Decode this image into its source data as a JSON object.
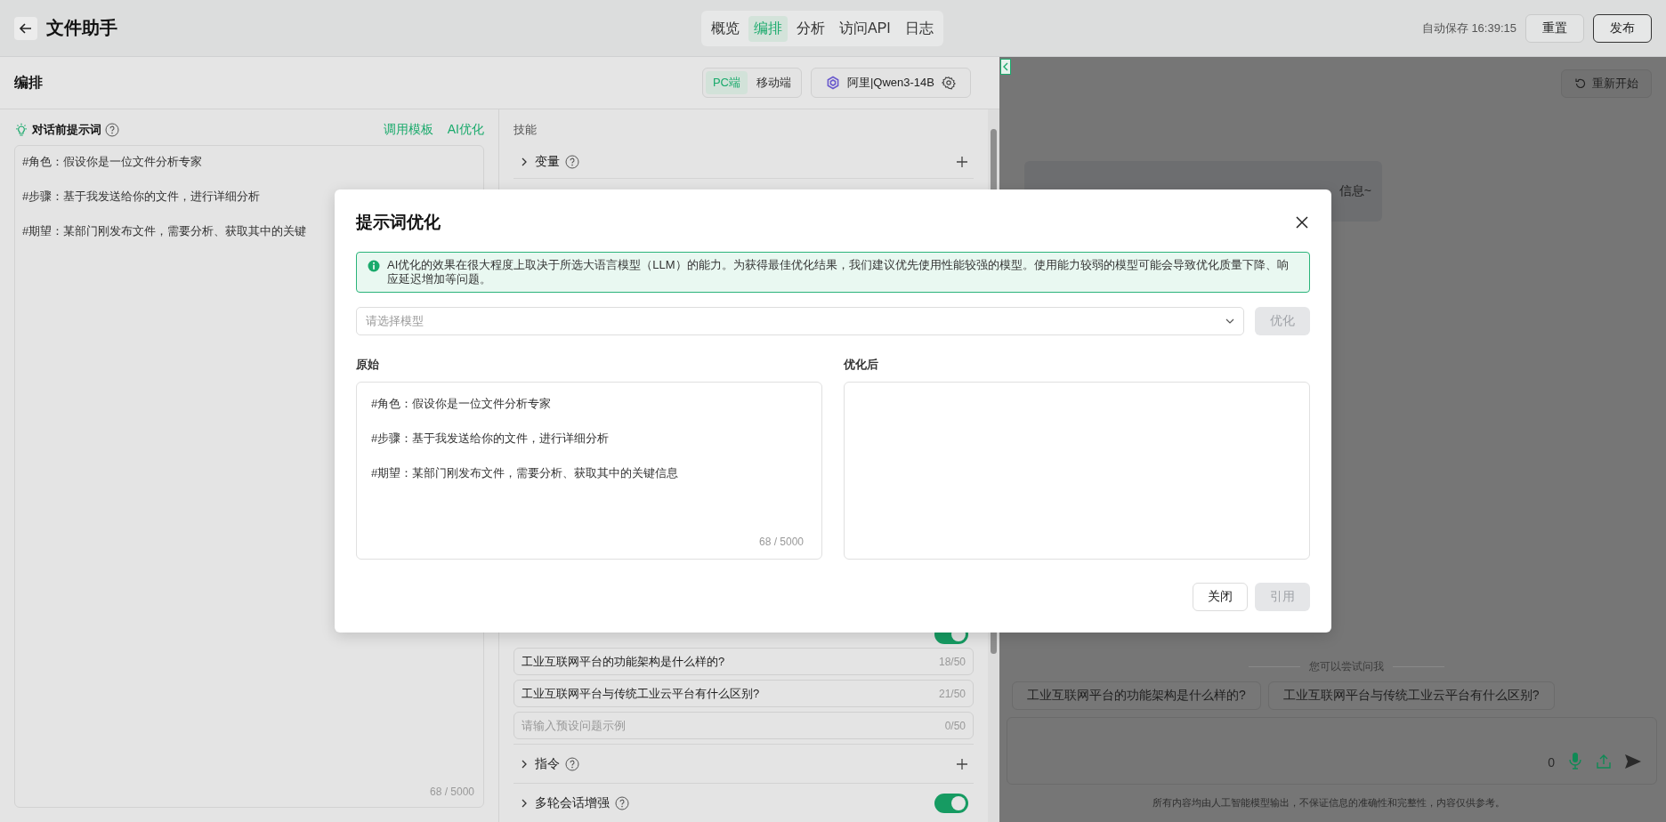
{
  "header": {
    "title": "文件助手",
    "tabs": [
      {
        "label": "概览",
        "selected": false
      },
      {
        "label": "编排",
        "selected": true
      },
      {
        "label": "分析",
        "selected": false
      },
      {
        "label": "访问API",
        "selected": false
      },
      {
        "label": "日志",
        "selected": false
      }
    ],
    "autosave": "自动保存 16:39:15",
    "buttons": [
      {
        "label": "重置",
        "kind": "default"
      },
      {
        "label": "发布",
        "kind": "outlined"
      }
    ]
  },
  "editor": {
    "title": "编排",
    "device_tabs": [
      {
        "label": "PC端",
        "selected": true
      },
      {
        "label": "移动端",
        "selected": false
      }
    ],
    "model": "阿里|Qwen3-14B"
  },
  "prompt": {
    "title": "对话前提示词",
    "links": [
      "调用模板",
      "AI优化"
    ],
    "lines": [
      "#角色：假设你是一位文件分析专家",
      "#步骤：基于我发送给你的文件，进行详细分析",
      "#期望：某部门刚发布文件，需要分析、获取其中的关键"
    ],
    "counter": "68 / 5000"
  },
  "skills": {
    "title": "技能",
    "top": [
      {
        "kind": "add",
        "label": "变量"
      }
    ],
    "questions_on": true,
    "questions": [
      {
        "text": "工业互联网平台的功能架构是什么样的?",
        "count": "18/50"
      },
      {
        "text": "工业互联网平台与传统工业云平台有什么区别?",
        "count": "21/50"
      }
    ],
    "question_placeholder": "请输入预设问题示例",
    "question_empty_count": "0/50",
    "bottom": [
      {
        "kind": "add",
        "label": "指令"
      },
      {
        "kind": "toggle",
        "label": "多轮会话增强",
        "on": true
      }
    ]
  },
  "preview": {
    "restart": "重新开始",
    "bubble": "信息~",
    "suggest_title": "您可以尝试问我",
    "suggestions": [
      "工业互联网平台的功能架构是什么样的?",
      "工业互联网平台与传统工业云平台有什么区别?"
    ],
    "input_count": "0",
    "disclaimer": "所有内容均由人工智能模型输出，不保证信息的准确性和完整性，内容仅供参考。"
  },
  "modal": {
    "title": "提示词优化",
    "notice": "AI优化的效果在很大程度上取决于所选大语言模型（LLM）的能力。为获得最佳优化结果，我们建议优先使用性能较强的模型。使用能力较弱的模型可能会导致优化质量下降、响应延迟增加等问题。",
    "model_placeholder": "请选择模型",
    "optimize": {
      "label": "优化",
      "disabled": true
    },
    "original_label": "原始",
    "original_lines": [
      "#角色：假设你是一位文件分析专家",
      "#步骤：基于我发送给你的文件，进行详细分析",
      "#期望：某部门刚发布文件，需要分析、获取其中的关键信息"
    ],
    "original_counter": "68 / 5000",
    "optimized_label": "优化后",
    "buttons": [
      {
        "label": "关闭",
        "disabled": false
      },
      {
        "label": "引用",
        "disabled": true
      }
    ]
  }
}
